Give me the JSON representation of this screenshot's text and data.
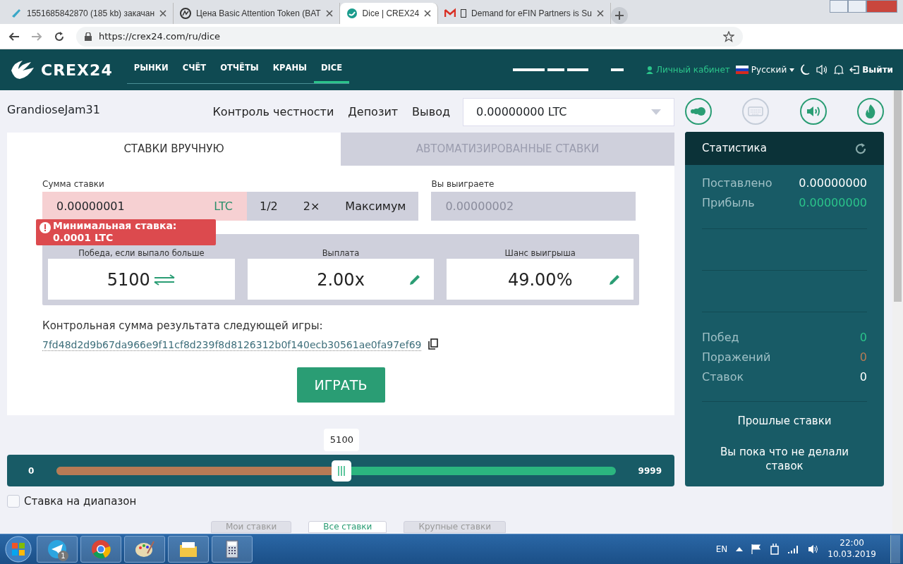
{
  "browser": {
    "tabs": [
      {
        "title": "1551685842870 (185 kb) закачан",
        "kind": "file",
        "selected": false
      },
      {
        "title": "Цена Basic Attention Token (BAT",
        "kind": "coin",
        "selected": false
      },
      {
        "title": "Dice | CREX24",
        "kind": "crex",
        "selected": true
      },
      {
        "title": "Demand for eFIN Partners is Su",
        "kind": "mail",
        "selected": false
      }
    ],
    "url": "https://crex24.com/ru/dice"
  },
  "site_nav": {
    "logo": "CREX24",
    "items": [
      {
        "label": "РЫНКИ",
        "selected": false
      },
      {
        "label": "СЧЁТ",
        "selected": false
      },
      {
        "label": "ОТЧЁТЫ",
        "selected": false
      },
      {
        "label": "КРАНЫ",
        "selected": false
      },
      {
        "label": "DICE",
        "selected": true
      }
    ],
    "account": "Личный кабинет",
    "language": "Русский",
    "logout": "Выйти"
  },
  "user": "GrandioseJam31",
  "header_links": [
    "Контроль честности",
    "Депозит",
    "Вывод"
  ],
  "balance": "0.00000000 LTC",
  "tool_icons": [
    {
      "kind": "dots",
      "disabled": false
    },
    {
      "kind": "keyboard",
      "disabled": true
    },
    {
      "kind": "sound",
      "disabled": false
    },
    {
      "kind": "fire",
      "disabled": false
    }
  ],
  "mode_tabs": [
    {
      "label": "СТАВКИ ВРУЧНУЮ",
      "selected": true
    },
    {
      "label": "АВТОМАТИЗИРОВАННЫЕ СТАВКИ",
      "selected": false
    }
  ],
  "bet": {
    "label": "Сумма ставки",
    "value": "0.00000001",
    "currency": "LTC",
    "invalid": true,
    "buttons": [
      "1/2",
      "2×",
      "Максимум"
    ],
    "error": "Минимальная ставка: 0.0001 LTC"
  },
  "win": {
    "label": "Вы выиграете",
    "value": "0.00000002"
  },
  "params": [
    {
      "label": "Победа, если выпало больше",
      "value": "5100",
      "kind": "swap"
    },
    {
      "label": "Выплата",
      "value": "2.00x",
      "kind": "edit"
    },
    {
      "label": "Шанс выигрыша",
      "value": "49.00%",
      "kind": "edit"
    }
  ],
  "checksum": {
    "label": "Контрольная сумма результата следующей игры:",
    "hash": "7fd48d2d9b67da966e9f11cf8d239f8d8126312b0f140ecb30561ae0fa97ef69"
  },
  "play_button": "ИГРАТЬ",
  "slider": {
    "min": "0",
    "max": "9999",
    "tooltip": "5100",
    "level": 0.51
  },
  "range_bet": {
    "label": "Ставка на диапазон",
    "checked": false
  },
  "history_tabs": [
    {
      "label": "Мои ставки",
      "selected": false
    },
    {
      "label": "Все ставки",
      "selected": true
    },
    {
      "label": "Крупные ставки",
      "selected": false
    }
  ],
  "stats": {
    "title": "Статистика",
    "totals": [
      {
        "label": "Поставлено",
        "value": "0.00000000",
        "color": "#ffffff"
      },
      {
        "label": "Прибыль",
        "value": "0.00000000",
        "color": "#2bc48a"
      }
    ],
    "counts": [
      {
        "label": "Побед",
        "value": "0",
        "color": "#2bc48a"
      },
      {
        "label": "Поражений",
        "value": "0",
        "color": "#b87a55"
      },
      {
        "label": "Ставок",
        "value": "0",
        "color": "#ffffff"
      }
    ],
    "history_title": "Прошлые ставки",
    "empty": "Вы пока что не делали ставок"
  },
  "taskbar": {
    "apps": [
      {
        "kind": "telegram",
        "badge": "1"
      },
      {
        "kind": "chrome"
      },
      {
        "kind": "paint"
      },
      {
        "kind": "explorer"
      },
      {
        "kind": "calculator"
      }
    ],
    "language": "EN",
    "time": "22:00",
    "date": "10.03.2019"
  }
}
